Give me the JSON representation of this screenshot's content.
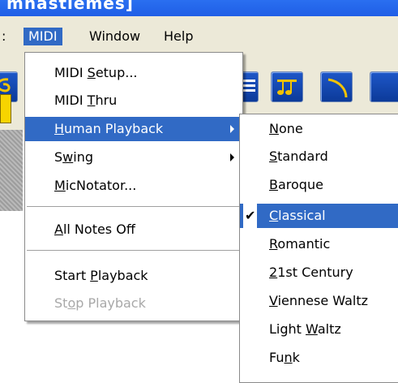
{
  "window": {
    "title": "mnastiemes]"
  },
  "menubar": {
    "items": [
      {
        "label": ":"
      },
      {
        "label": "MIDI"
      },
      {
        "label": "Window"
      },
      {
        "label": "Help"
      }
    ]
  },
  "toolbar": {
    "icons": [
      "clef-icon",
      "score-icon",
      "notes-icon",
      "slur-icon"
    ]
  },
  "midi_menu": {
    "items": [
      {
        "pre": "MIDI ",
        "u": "S",
        "post": "etup..."
      },
      {
        "pre": "MIDI ",
        "u": "T",
        "post": "hru"
      },
      {
        "pre": "",
        "u": "H",
        "post": "uman Playback"
      },
      {
        "pre": "S",
        "u": "w",
        "post": "ing"
      },
      {
        "pre": "",
        "u": "M",
        "post": "icNotator..."
      },
      {
        "pre": "",
        "u": "A",
        "post": "ll Notes Off"
      },
      {
        "pre": "Start ",
        "u": "P",
        "post": "layback"
      },
      {
        "pre": "St",
        "u": "o",
        "post": "p Playback"
      }
    ]
  },
  "human_playback_menu": {
    "items": [
      {
        "pre": "",
        "u": "N",
        "post": "one"
      },
      {
        "pre": "",
        "u": "S",
        "post": "tandard"
      },
      {
        "pre": "",
        "u": "B",
        "post": "aroque"
      },
      {
        "pre": "",
        "u": "C",
        "post": "lassical"
      },
      {
        "pre": "",
        "u": "R",
        "post": "omantic"
      },
      {
        "pre": "",
        "u": "2",
        "post": "1st Century"
      },
      {
        "pre": "",
        "u": "V",
        "post": "iennese Waltz"
      },
      {
        "pre": "Light ",
        "u": "W",
        "post": "altz"
      },
      {
        "pre": "Fu",
        "u": "n",
        "post": "k"
      }
    ],
    "checked": "Classical",
    "check_mark": "✔"
  }
}
